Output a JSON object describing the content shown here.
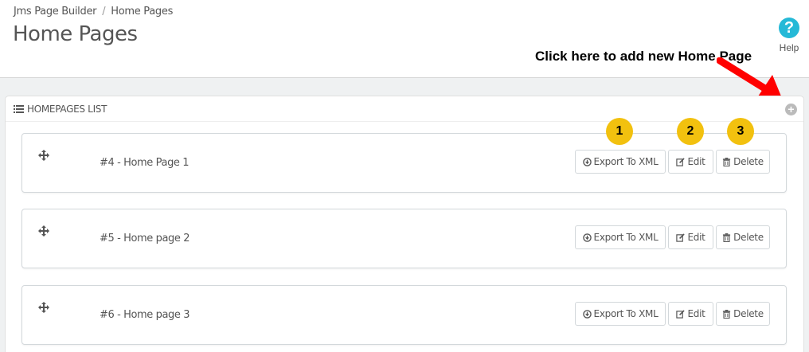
{
  "breadcrumb": {
    "parent": "Jms Page Builder",
    "separator": "/",
    "current": "Home Pages"
  },
  "page_title": "Home Pages",
  "help": {
    "icon": "question-circle-icon",
    "label": "Help"
  },
  "annotation": {
    "text": "Click here to add new Home Page",
    "color": "#ff0000"
  },
  "panel": {
    "title": "HOMEPAGES LIST",
    "add_icon": "plus-circle-icon"
  },
  "rows": [
    {
      "name": "#4 - Home Page 1",
      "export_label": "Export To XML",
      "edit_label": "Edit",
      "delete_label": "Delete"
    },
    {
      "name": "#5 - Home page 2",
      "export_label": "Export To XML",
      "edit_label": "Edit",
      "delete_label": "Delete"
    },
    {
      "name": "#6 - Home page 3",
      "export_label": "Export To XML",
      "edit_label": "Edit",
      "delete_label": "Delete"
    }
  ],
  "markers": [
    "1",
    "2",
    "3"
  ],
  "colors": {
    "accent": "#25b9d7",
    "marker": "#f2c10f",
    "background": "#eff1f2"
  }
}
